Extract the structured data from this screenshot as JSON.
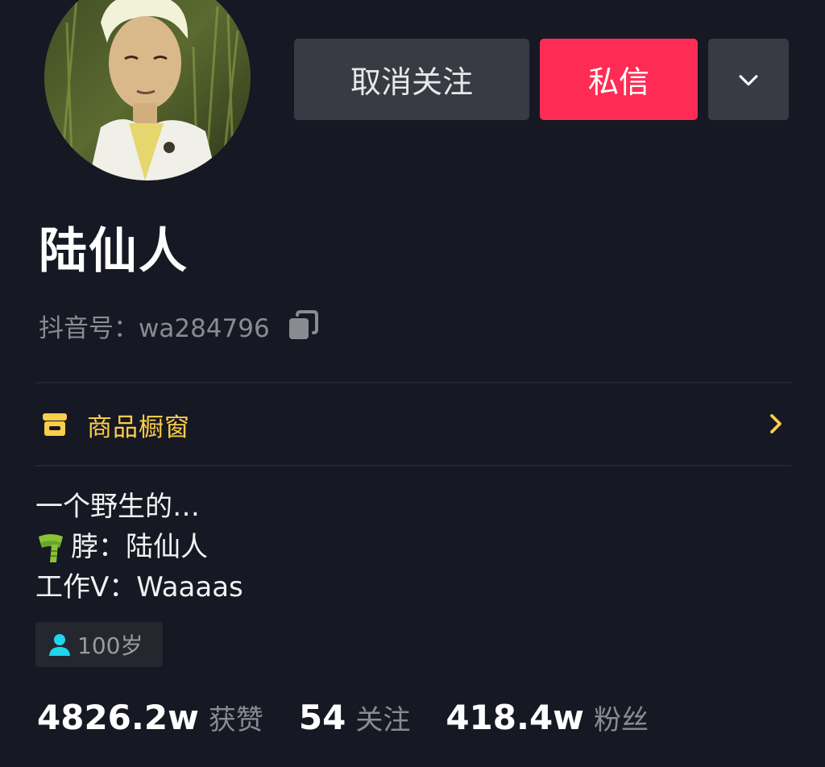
{
  "header": {
    "unfollow_label": "取消关注",
    "message_label": "私信",
    "more_icon": "chevron-down-icon"
  },
  "profile": {
    "name": "陆仙人",
    "douyin_id": "抖音号：wa284796",
    "copy_icon": "copy-icon"
  },
  "shop": {
    "label": "商品橱窗",
    "icon": "shop-icon",
    "chevron_icon": "chevron-right-icon"
  },
  "bio": {
    "lines": [
      "一个野生的…",
      "脖：陆仙人",
      "工作V：Waaaas"
    ]
  },
  "tags": {
    "age": "100岁",
    "age_icon": "person-icon"
  },
  "stats": [
    {
      "value": "4826.2w",
      "label": "获赞"
    },
    {
      "value": "54",
      "label": "关注"
    },
    {
      "value": "418.4w",
      "label": "粉丝"
    }
  ],
  "colors": {
    "background": "#161823",
    "accent": "#fe2c55",
    "button_gray": "#393b44",
    "shop_yellow": "#facd4a",
    "muted_text": "#8a8b91",
    "age_icon": "#20d5ec"
  }
}
